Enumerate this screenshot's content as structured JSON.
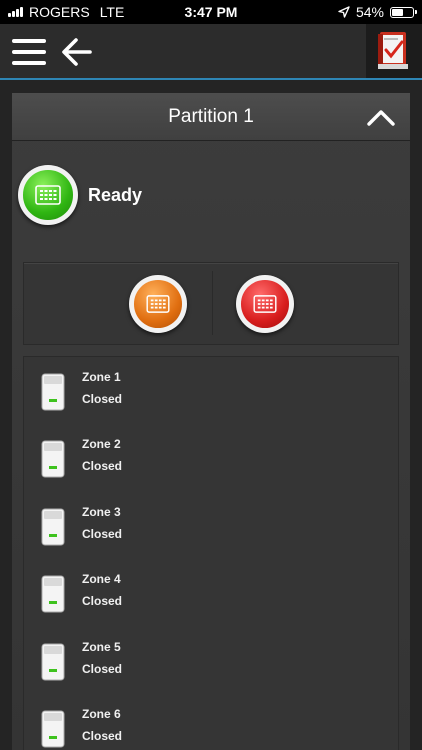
{
  "status_bar": {
    "carrier": "ROGERS",
    "network": "LTE",
    "time": "3:47 PM",
    "battery": "54%",
    "battery_level": 0.54
  },
  "icons": {
    "menu": "hamburger-menu-icon",
    "back": "arrow-left-icon",
    "app": "checklist-book-icon",
    "collapse": "chevron-up-icon",
    "keypad": "keypad-icon",
    "sensor": "motion-sensor-icon"
  },
  "colors": {
    "ready": "#2fb512",
    "arm_stay": "#e06e10",
    "arm_away": "#d81d1d",
    "accent": "#2e86b5"
  },
  "partition": {
    "title": "Partition 1",
    "status": "Ready"
  },
  "zones": [
    {
      "name": "Zone 1",
      "status": "Closed"
    },
    {
      "name": "Zone 2",
      "status": "Closed"
    },
    {
      "name": "Zone 3",
      "status": "Closed"
    },
    {
      "name": "Zone 4",
      "status": "Closed"
    },
    {
      "name": "Zone 5",
      "status": "Closed"
    },
    {
      "name": "Zone 6",
      "status": "Closed"
    }
  ]
}
